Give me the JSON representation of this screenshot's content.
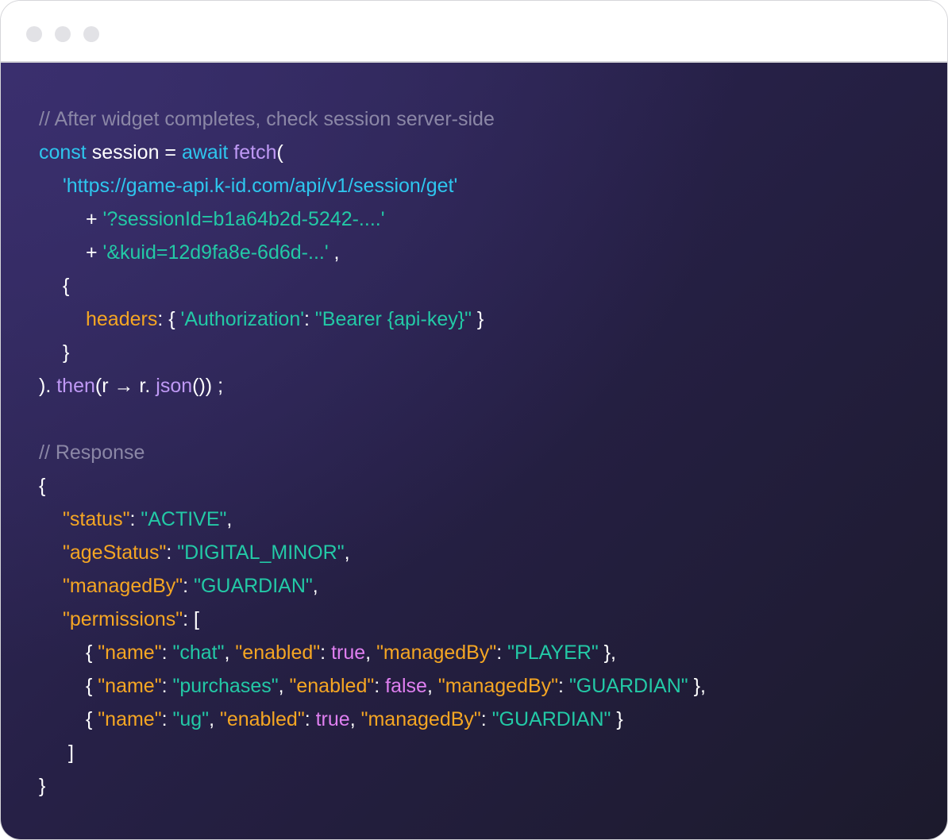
{
  "code_lines": [
    {
      "indent": 0,
      "tokens": [
        {
          "t": "// After widget completes, check session server-side",
          "c": "comment"
        }
      ]
    },
    {
      "indent": 0,
      "tokens": [
        {
          "t": "const",
          "c": "kw"
        },
        {
          "t": " session = ",
          "c": "p"
        },
        {
          "t": "await",
          "c": "kw"
        },
        {
          "t": " ",
          "c": "p"
        },
        {
          "t": "fetch",
          "c": "fn"
        },
        {
          "t": "(",
          "c": "p"
        }
      ]
    },
    {
      "indent": 1,
      "tokens": [
        {
          "t": "'https://game-api.k-id.com/api/v1/session/get'",
          "c": "url"
        }
      ]
    },
    {
      "indent": 2,
      "tokens": [
        {
          "t": "+ ",
          "c": "p"
        },
        {
          "t": "'?sessionId=b1a64b2d-5242-....'",
          "c": "str"
        }
      ]
    },
    {
      "indent": 2,
      "tokens": [
        {
          "t": "+ ",
          "c": "p"
        },
        {
          "t": "'&kuid=12d9fa8e-6d6d-...'",
          "c": "str"
        },
        {
          "t": " ,",
          "c": "p"
        }
      ]
    },
    {
      "indent": 1,
      "tokens": [
        {
          "t": "{",
          "c": "p"
        }
      ]
    },
    {
      "indent": 2,
      "tokens": [
        {
          "t": "headers",
          "c": "key"
        },
        {
          "t": ": { ",
          "c": "p"
        },
        {
          "t": "'Authorization'",
          "c": "str"
        },
        {
          "t": ": ",
          "c": "p"
        },
        {
          "t": "\"Bearer {api-key}\"",
          "c": "str"
        },
        {
          "t": " }",
          "c": "p"
        }
      ]
    },
    {
      "indent": 1,
      "tokens": [
        {
          "t": "}",
          "c": "p"
        }
      ]
    },
    {
      "indent": 0,
      "tokens": [
        {
          "t": "). ",
          "c": "p"
        },
        {
          "t": "then",
          "c": "fn"
        },
        {
          "t": "(r → r. ",
          "c": "p"
        },
        {
          "t": "json",
          "c": "fn"
        },
        {
          "t": "()) ;",
          "c": "p"
        }
      ]
    },
    {
      "indent": 0,
      "tokens": []
    },
    {
      "indent": 0,
      "tokens": [
        {
          "t": "// Response",
          "c": "comment"
        }
      ]
    },
    {
      "indent": 0,
      "tokens": [
        {
          "t": "{",
          "c": "p"
        }
      ]
    },
    {
      "indent": 1,
      "tokens": [
        {
          "t": "\"status\"",
          "c": "key"
        },
        {
          "t": ": ",
          "c": "p"
        },
        {
          "t": "\"ACTIVE\"",
          "c": "str"
        },
        {
          "t": ",",
          "c": "p"
        }
      ]
    },
    {
      "indent": 1,
      "tokens": [
        {
          "t": "\"ageStatus\"",
          "c": "key"
        },
        {
          "t": ": ",
          "c": "p"
        },
        {
          "t": "\"DIGITAL_MINOR\"",
          "c": "str"
        },
        {
          "t": ",",
          "c": "p"
        }
      ]
    },
    {
      "indent": 1,
      "tokens": [
        {
          "t": "\"managedBy\"",
          "c": "key"
        },
        {
          "t": ": ",
          "c": "p"
        },
        {
          "t": "\"GUARDIAN\"",
          "c": "str"
        },
        {
          "t": ",",
          "c": "p"
        }
      ]
    },
    {
      "indent": 1,
      "tokens": [
        {
          "t": "\"permissions\"",
          "c": "key"
        },
        {
          "t": ": [",
          "c": "p"
        }
      ]
    },
    {
      "indent": 2,
      "tokens": [
        {
          "t": "{ ",
          "c": "p"
        },
        {
          "t": "\"name\"",
          "c": "key"
        },
        {
          "t": ": ",
          "c": "p"
        },
        {
          "t": "\"chat\"",
          "c": "str"
        },
        {
          "t": ", ",
          "c": "p"
        },
        {
          "t": "\"enabled\"",
          "c": "key"
        },
        {
          "t": ": ",
          "c": "p"
        },
        {
          "t": "true",
          "c": "bool"
        },
        {
          "t": ", ",
          "c": "p"
        },
        {
          "t": "\"managedBy\"",
          "c": "key"
        },
        {
          "t": ": ",
          "c": "p"
        },
        {
          "t": "\"PLAYER\"",
          "c": "str"
        },
        {
          "t": " },",
          "c": "p"
        }
      ]
    },
    {
      "indent": 2,
      "tokens": [
        {
          "t": "{ ",
          "c": "p"
        },
        {
          "t": "\"name\"",
          "c": "key"
        },
        {
          "t": ": ",
          "c": "p"
        },
        {
          "t": "\"purchases\"",
          "c": "str"
        },
        {
          "t": ", ",
          "c": "p"
        },
        {
          "t": "\"enabled\"",
          "c": "key"
        },
        {
          "t": ": ",
          "c": "p"
        },
        {
          "t": "false",
          "c": "bool"
        },
        {
          "t": ", ",
          "c": "p"
        },
        {
          "t": "\"managedBy\"",
          "c": "key"
        },
        {
          "t": ": ",
          "c": "p"
        },
        {
          "t": "\"GUARDIAN\"",
          "c": "str"
        },
        {
          "t": " },",
          "c": "p"
        }
      ]
    },
    {
      "indent": 2,
      "tokens": [
        {
          "t": "{ ",
          "c": "p"
        },
        {
          "t": "\"name\"",
          "c": "key"
        },
        {
          "t": ": ",
          "c": "p"
        },
        {
          "t": "\"ug\"",
          "c": "str"
        },
        {
          "t": ", ",
          "c": "p"
        },
        {
          "t": "\"enabled\"",
          "c": "key"
        },
        {
          "t": ": ",
          "c": "p"
        },
        {
          "t": "true",
          "c": "bool"
        },
        {
          "t": ", ",
          "c": "p"
        },
        {
          "t": "\"managedBy\"",
          "c": "key"
        },
        {
          "t": ": ",
          "c": "p"
        },
        {
          "t": "\"GUARDIAN\"",
          "c": "str"
        },
        {
          "t": " }",
          "c": "p"
        }
      ]
    },
    {
      "indent": 1,
      "tokens": [
        {
          "t": " ]",
          "c": "p"
        }
      ]
    },
    {
      "indent": 0,
      "tokens": [
        {
          "t": "}",
          "c": "p"
        }
      ]
    }
  ],
  "colors": {
    "comment": "#8b87a6",
    "keyword": "#2ec6ee",
    "function": "#bf99f5",
    "string": "#23c9a6",
    "key": "#f5a623",
    "boolean": "#df7ff0",
    "punctuation": "#ffffff"
  }
}
